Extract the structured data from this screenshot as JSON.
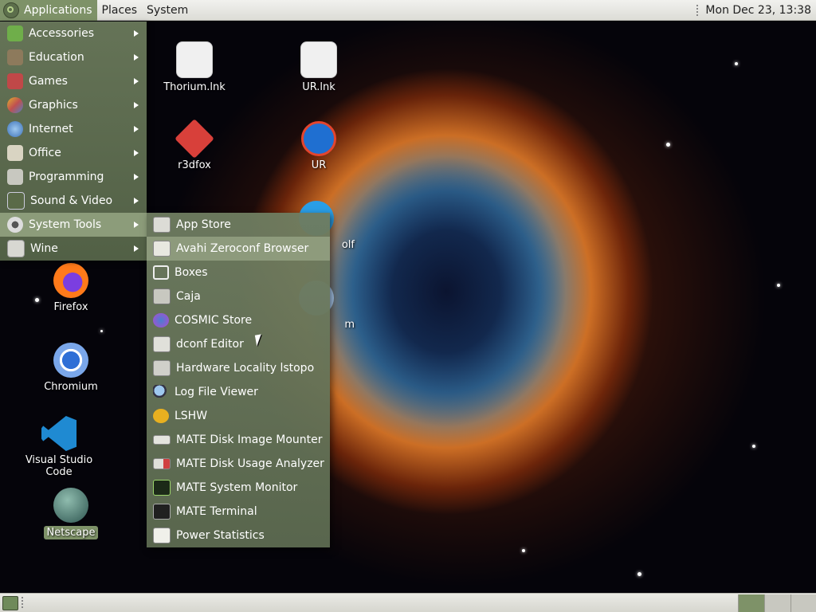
{
  "top_panel": {
    "applications": "Applications",
    "places": "Places",
    "system": "System",
    "clock": "Mon Dec 23, 13:38"
  },
  "app_menu": {
    "items": [
      {
        "label": "Accessories",
        "icon": "accessories-icon"
      },
      {
        "label": "Education",
        "icon": "education-icon"
      },
      {
        "label": "Games",
        "icon": "games-icon"
      },
      {
        "label": "Graphics",
        "icon": "graphics-icon"
      },
      {
        "label": "Internet",
        "icon": "internet-icon"
      },
      {
        "label": "Office",
        "icon": "office-icon"
      },
      {
        "label": "Programming",
        "icon": "programming-icon"
      },
      {
        "label": "Sound & Video",
        "icon": "sound-video-icon"
      },
      {
        "label": "System Tools",
        "icon": "system-tools-icon"
      },
      {
        "label": "Wine",
        "icon": "wine-icon"
      }
    ]
  },
  "submenu": {
    "items": [
      {
        "label": "App Store"
      },
      {
        "label": "Avahi Zeroconf Browser"
      },
      {
        "label": "Boxes"
      },
      {
        "label": "Caja"
      },
      {
        "label": "COSMIC Store"
      },
      {
        "label": "dconf Editor"
      },
      {
        "label": "Hardware Locality lstopo"
      },
      {
        "label": "Log File Viewer"
      },
      {
        "label": "LSHW"
      },
      {
        "label": "MATE Disk Image Mounter"
      },
      {
        "label": "MATE Disk Usage Analyzer"
      },
      {
        "label": "MATE System Monitor"
      },
      {
        "label": "MATE Terminal"
      },
      {
        "label": "Power Statistics"
      }
    ]
  },
  "desktop": {
    "icons": [
      {
        "label": "Thorium.lnk"
      },
      {
        "label": "UR.lnk"
      },
      {
        "label": "r3dfox"
      },
      {
        "label": "UR"
      },
      {
        "label": "olf"
      },
      {
        "label": "m"
      },
      {
        "label": "Firefox"
      },
      {
        "label": "Chromium"
      },
      {
        "label": "Visual Studio Code"
      },
      {
        "label": "Netscape"
      }
    ]
  }
}
